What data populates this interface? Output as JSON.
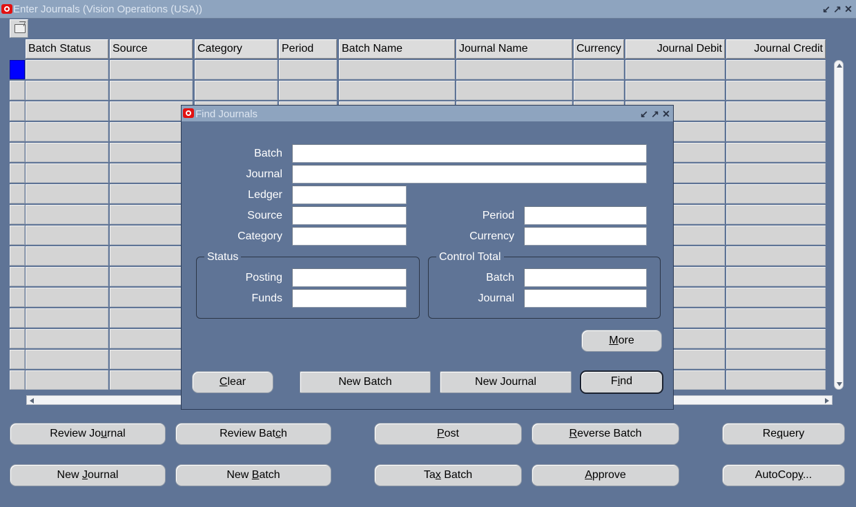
{
  "window": {
    "title": "Enter Journals (Vision Operations (USA))",
    "controls": [
      "minimize-icon",
      "restore-icon",
      "close-icon"
    ]
  },
  "grid": {
    "columns": [
      "Batch Status",
      "Source",
      "Category",
      "Period",
      "Batch Name",
      "Journal Name",
      "Currency",
      "Journal Debit",
      "Journal Credit"
    ],
    "row_count": 16,
    "current_row": 1
  },
  "dialog": {
    "title": "Find Journals",
    "fields": {
      "batch": {
        "label": "Batch",
        "value": ""
      },
      "journal": {
        "label": "Journal",
        "value": ""
      },
      "ledger": {
        "label": "Ledger",
        "value": ""
      },
      "source": {
        "label": "Source",
        "value": ""
      },
      "category": {
        "label": "Category",
        "value": ""
      },
      "period": {
        "label": "Period",
        "value": ""
      },
      "currency": {
        "label": "Currency",
        "value": ""
      }
    },
    "status_group": {
      "legend": "Status",
      "posting": {
        "label": "Posting",
        "value": ""
      },
      "funds": {
        "label": "Funds",
        "value": ""
      }
    },
    "control_total_group": {
      "legend": "Control Total",
      "batch": {
        "label": "Batch",
        "value": ""
      },
      "journal": {
        "label": "Journal",
        "value": ""
      }
    },
    "buttons": {
      "more": {
        "pre": "",
        "key": "M",
        "post": "ore"
      },
      "clear": {
        "pre": "",
        "key": "C",
        "post": "lear"
      },
      "new_batch": {
        "label": "New Batch"
      },
      "new_journal": {
        "label": "New Journal"
      },
      "find": {
        "pre": "F",
        "key": "i",
        "post": "nd"
      }
    }
  },
  "bottom_buttons": {
    "review_journal": {
      "pre": "Review Jo",
      "key": "u",
      "post": "rnal"
    },
    "review_batch": {
      "pre": "Review Bat",
      "key": "c",
      "post": "h"
    },
    "post": {
      "pre": "",
      "key": "P",
      "post": "ost"
    },
    "reverse_batch": {
      "pre": "",
      "key": "R",
      "post": "everse Batch"
    },
    "requery": {
      "pre": "Re",
      "key": "q",
      "post": "uery"
    },
    "new_journal": {
      "pre": "New ",
      "key": "J",
      "post": "ournal"
    },
    "new_batch": {
      "pre": "New ",
      "key": "B",
      "post": "atch"
    },
    "tax_batch": {
      "pre": "Ta",
      "key": "x",
      "post": " Batch"
    },
    "approve": {
      "pre": "",
      "key": "A",
      "post": "pprove"
    },
    "autocopy": {
      "pre": "AutoCop",
      "key": "y",
      "post": "..."
    }
  },
  "colors": {
    "background": "#5f7496",
    "titlebar": "#8ea4bf",
    "current_row_indicator": "#0000ff"
  }
}
